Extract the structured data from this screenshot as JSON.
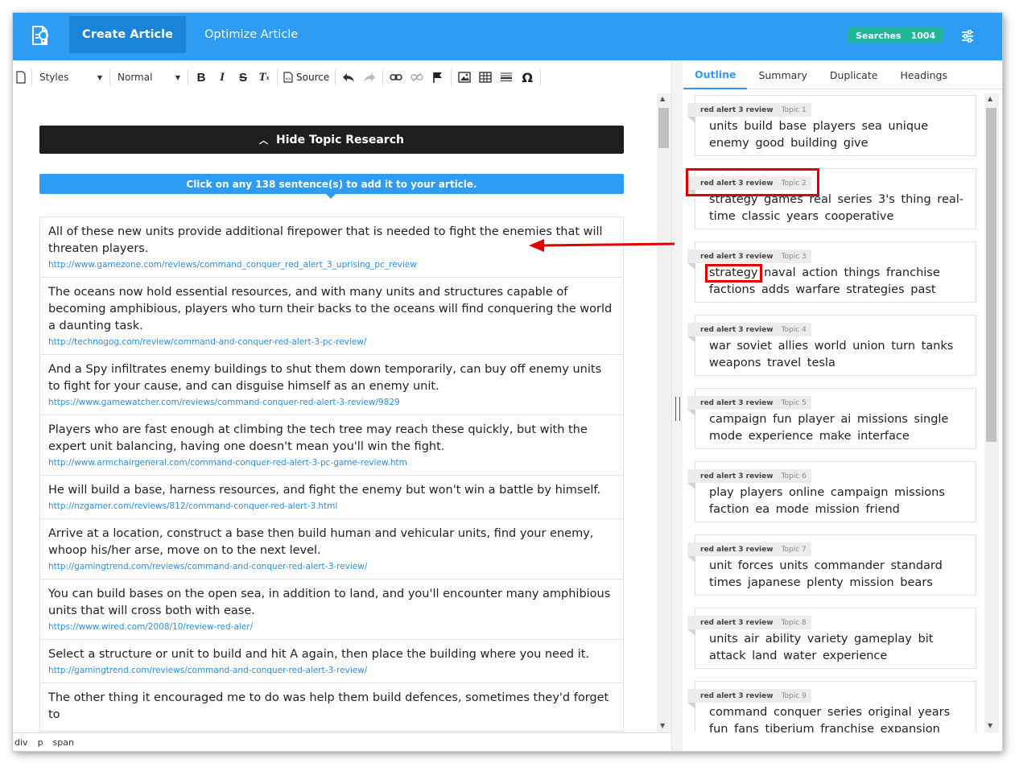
{
  "header": {
    "create_tab": "Create Article",
    "optimize_tab": "Optimize Article",
    "searches_label": "Searches",
    "searches_count": "1004",
    "accent": "#2e9cf3",
    "badge_color": "#1fb59a"
  },
  "toolbar": {
    "styles_label": "Styles",
    "format_label": "Normal",
    "source_label": "Source",
    "icons": [
      "document-icon",
      "bold-icon",
      "italic-icon",
      "strikethrough-icon",
      "remove-format-icon",
      "source-icon",
      "undo-icon",
      "redo-icon",
      "link-icon",
      "unlink-icon",
      "flag-icon",
      "image-icon",
      "table-icon",
      "horizontal-rule-icon",
      "omega-icon"
    ]
  },
  "research": {
    "hide_label": "Hide Topic Research",
    "banner": "Click on any 138 sentence(s) to add it to your article.",
    "sentences": [
      {
        "text": "All of these new units provide additional firepower that is needed to fight the enemies that will threaten players.",
        "url": "http://www.gamezone.com/reviews/command_conquer_red_alert_3_uprising_pc_review"
      },
      {
        "text": "The oceans now hold essential resources, and with many units and structures capable of becoming amphibious, players who turn their backs to the oceans will find conquering the world a daunting task.",
        "url": "http://technogog.com/review/command-and-conquer-red-alert-3-pc-review/"
      },
      {
        "text": "And a Spy infiltrates enemy buildings to shut them down temporarily, can buy off enemy units to fight for your cause, and can disguise himself as an enemy unit.",
        "url": "https://www.gamewatcher.com/reviews/command-conquer-red-alert-3-review/9829"
      },
      {
        "text": "Players who are fast enough at climbing the tech tree may reach these quickly, but with the expert unit balancing, having one doesn't mean you'll win the fight.",
        "url": "http://www.armchairgeneral.com/command-conquer-red-alert-3-pc-game-review.htm"
      },
      {
        "text": "He will build a base, harness resources, and fight the enemy but won't win a battle by himself.",
        "url": "http://nzgamer.com/reviews/812/command-conquer-red-alert-3.html"
      },
      {
        "text": "Arrive at a location, construct a base then build human and vehicular units, find your enemy, whoop his/her arse, move on to the next level.",
        "url": "http://gamingtrend.com/reviews/command-and-conquer-red-alert-3-review/"
      },
      {
        "text": "You can build bases on the open sea, in addition to land, and you'll encounter many amphibious units that will cross both with ease.",
        "url": "https://www.wired.com/2008/10/review-red-aler/"
      },
      {
        "text": "Select a structure or unit to build and hit A again, then place the building where you need it.",
        "url": "http://gamingtrend.com/reviews/command-and-conquer-red-alert-3-review/"
      },
      {
        "text": "The other thing it encouraged me to do was help them build defences, sometimes they'd forget to",
        "url": ""
      }
    ]
  },
  "statusbar": {
    "items": [
      "div",
      "p",
      "span"
    ]
  },
  "right_panel": {
    "tabs": [
      "Outline",
      "Summary",
      "Duplicate",
      "Headings"
    ],
    "topics": [
      {
        "keyword": "red alert 3 review",
        "label": "Topic 1",
        "words": "units build base players sea unique enemy good building give"
      },
      {
        "keyword": "red alert 3 review",
        "label": "Topic 2",
        "words": "strategy games real series 3's thing real-time classic years cooperative"
      },
      {
        "keyword": "red alert 3 review",
        "label": "Topic 3",
        "words": "strategy naval action things franchise factions adds warfare strategies past"
      },
      {
        "keyword": "red alert 3 review",
        "label": "Topic 4",
        "words": "war soviet allies world union turn tanks weapons travel tesla"
      },
      {
        "keyword": "red alert 3 review",
        "label": "Topic 5",
        "words": "campaign fun player ai missions single mode experience make interface"
      },
      {
        "keyword": "red alert 3 review",
        "label": "Topic 6",
        "words": "play players online campaign missions faction ea mode mission friend"
      },
      {
        "keyword": "red alert 3 review",
        "label": "Topic 7",
        "words": "unit forces units commander standard times japanese plenty mission bears"
      },
      {
        "keyword": "red alert 3 review",
        "label": "Topic 8",
        "words": "units air ability variety gameplay bit attack land water experience"
      },
      {
        "keyword": "red alert 3 review",
        "label": "Topic 9",
        "words": "command conquer series original years fun fans tiberium franchise expansion"
      }
    ]
  }
}
